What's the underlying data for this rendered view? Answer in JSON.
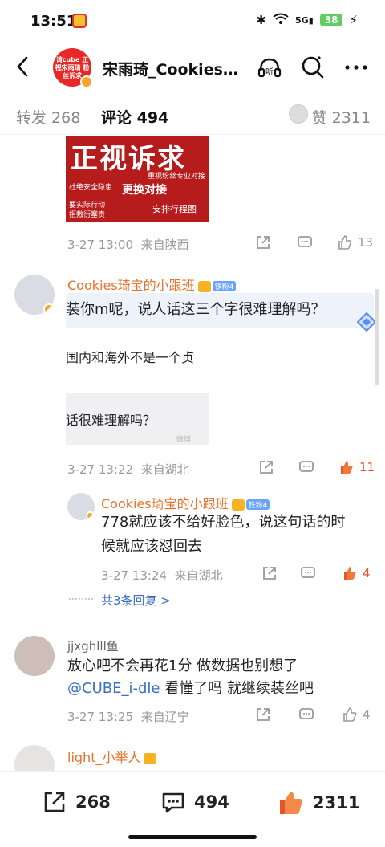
{
  "status_bar": {
    "time": "13:51",
    "network": "5G",
    "battery": "38"
  },
  "header": {
    "title": "宋雨琦_Cookies...",
    "avatar_text": "请cube 正视宋雨琦 粉丝诉求"
  },
  "tabs": {
    "repost": "转发 268",
    "comment": "评论 494",
    "like": "赞 2311"
  },
  "post_image": {
    "main": "正视诉求",
    "line1": "重视粉丝专业对接",
    "line2": "杜绝安全隐患",
    "line3": "更换对接",
    "line4": "要实际行动",
    "line5": "拒敷衍塞责",
    "line6": "安排行程图"
  },
  "comment0": {
    "time": "3-27 13:00",
    "location": "来自陕西",
    "likes": "13"
  },
  "comment1": {
    "user": "Cookies琦宝的小跟班",
    "fan_badge": "铁粉4",
    "text": "装你m呢，说人话这三个字很难理解吗？",
    "snippet1": "国内和海外不是一个贞",
    "snippet2": "话很难理解吗？",
    "time": "3-27 13:22",
    "location": "来自湖北",
    "likes": "11"
  },
  "reply1": {
    "user": "Cookies琦宝的小跟班",
    "fan_badge": "铁粉4",
    "text_line1": "778就应该不给好脸色，说这句话的时",
    "text_line2": "候就应该怼回去",
    "time": "3-27 13:24",
    "location": "来自湖北",
    "likes": "4",
    "more": "共3条回复 >"
  },
  "comment2": {
    "user": "jjxghlll鱼",
    "text_line1": "放心吧不会再花1分 做数据也别想了",
    "mention": "@CUBE_i-dle",
    "text_line2_rest": " 看懂了吗 就继续装丝吧",
    "time": "3-27 13:25",
    "location": "来自辽宁",
    "likes": "4"
  },
  "comment3": {
    "user": "light_小举人"
  },
  "bottom_bar": {
    "repost": "268",
    "comment": "494",
    "like": "2311"
  }
}
